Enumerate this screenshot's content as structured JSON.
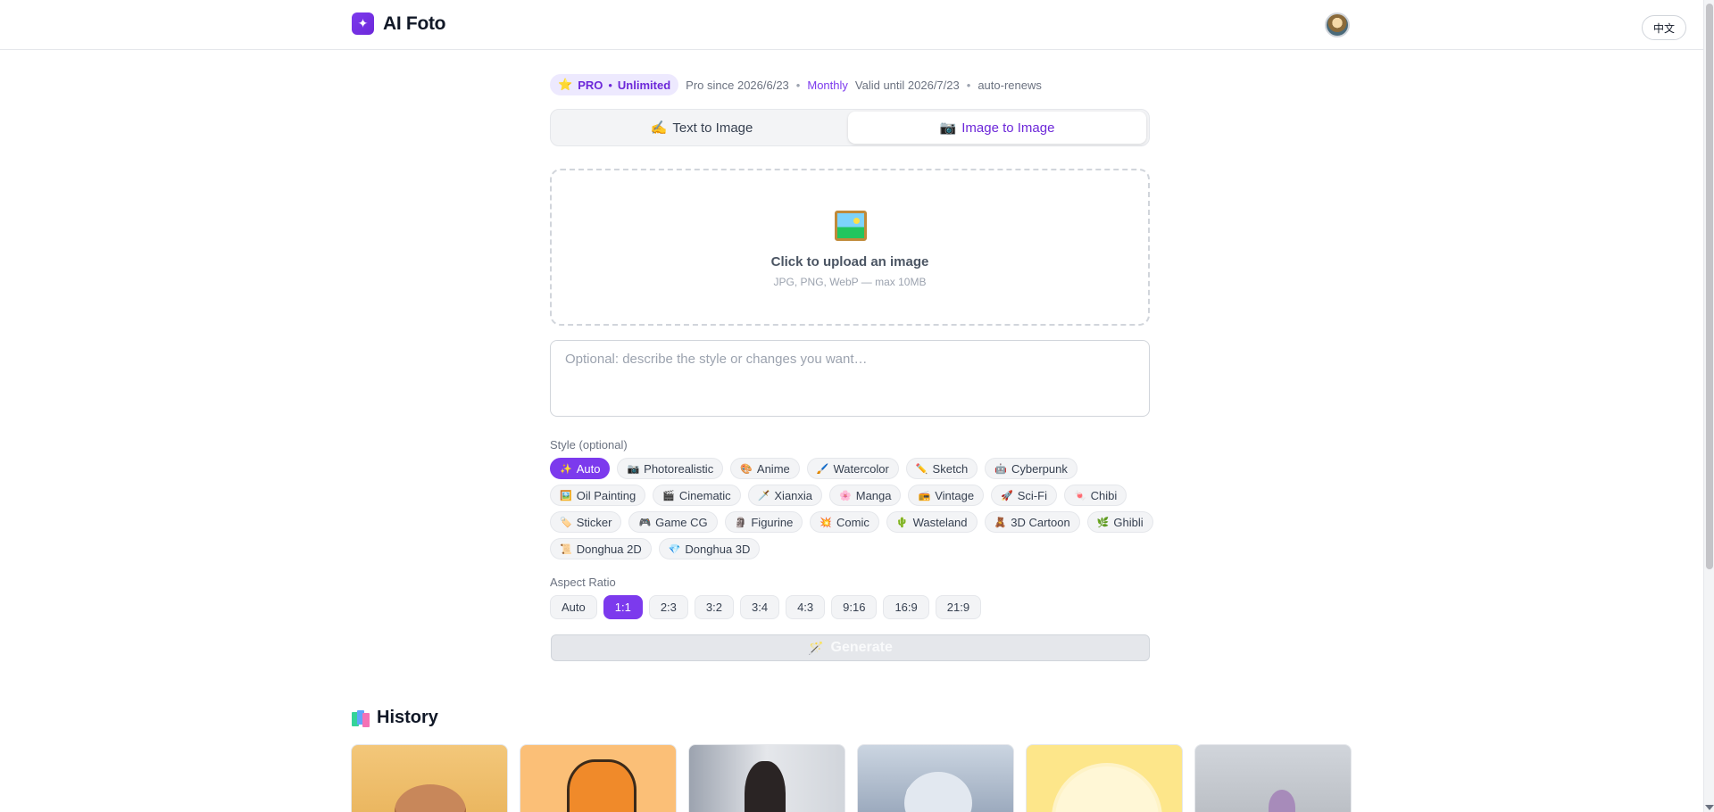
{
  "app": {
    "name": "AI Foto",
    "logo_glyph": "✦",
    "lang_button": "中文",
    "accent": "#7c3aed"
  },
  "plan": {
    "badge_icon": "⭐",
    "badge_pro": "PRO",
    "badge_sep": "•",
    "badge_unlimited": "Unlimited",
    "since": "Pro since 2026/6/23",
    "sep": "•",
    "cycle": "Monthly",
    "valid": "Valid until 2026/7/23",
    "renew": "auto-renews"
  },
  "tabs": [
    {
      "icon": "✍️",
      "label": "Text to Image",
      "active": false
    },
    {
      "icon": "📷",
      "label": "Image to Image",
      "active": true
    }
  ],
  "upload": {
    "icon": "framed-picture-icon",
    "title": "Click to upload an image",
    "hint": "JPG, PNG, WebP — max 10MB"
  },
  "prompt": {
    "placeholder": "Optional: describe the style or changes you want…",
    "value": ""
  },
  "style": {
    "label": "Style (optional)",
    "options": [
      {
        "icon": "✨",
        "label": "Auto",
        "active": true
      },
      {
        "icon": "📷",
        "label": "Photorealistic"
      },
      {
        "icon": "🎨",
        "label": "Anime"
      },
      {
        "icon": "🖌️",
        "label": "Watercolor"
      },
      {
        "icon": "✏️",
        "label": "Sketch"
      },
      {
        "icon": "🤖",
        "label": "Cyberpunk"
      },
      {
        "icon": "🖼️",
        "label": "Oil Painting"
      },
      {
        "icon": "🎬",
        "label": "Cinematic"
      },
      {
        "icon": "🗡️",
        "label": "Xianxia"
      },
      {
        "icon": "🌸",
        "label": "Manga"
      },
      {
        "icon": "📻",
        "label": "Vintage"
      },
      {
        "icon": "🚀",
        "label": "Sci-Fi"
      },
      {
        "icon": "🍬",
        "label": "Chibi"
      },
      {
        "icon": "🏷️",
        "label": "Sticker"
      },
      {
        "icon": "🎮",
        "label": "Game CG"
      },
      {
        "icon": "🗿",
        "label": "Figurine"
      },
      {
        "icon": "💥",
        "label": "Comic"
      },
      {
        "icon": "🌵",
        "label": "Wasteland"
      },
      {
        "icon": "🧸",
        "label": "3D Cartoon"
      },
      {
        "icon": "🌿",
        "label": "Ghibli"
      },
      {
        "icon": "📜",
        "label": "Donghua 2D"
      },
      {
        "icon": "💎",
        "label": "Donghua 3D"
      }
    ]
  },
  "aspect": {
    "label": "Aspect Ratio",
    "options": [
      {
        "label": "Auto"
      },
      {
        "label": "1:1",
        "active": true
      },
      {
        "label": "2:3"
      },
      {
        "label": "3:2"
      },
      {
        "label": "3:4"
      },
      {
        "label": "4:3"
      },
      {
        "label": "9:16"
      },
      {
        "label": "16:9"
      },
      {
        "label": "21:9"
      }
    ]
  },
  "generate": {
    "icon": "🪄",
    "label": "Generate",
    "disabled": true
  },
  "history": {
    "title": "History",
    "items": [
      "monkey",
      "tiger",
      "woman",
      "mouse",
      "chick",
      "figure"
    ]
  }
}
